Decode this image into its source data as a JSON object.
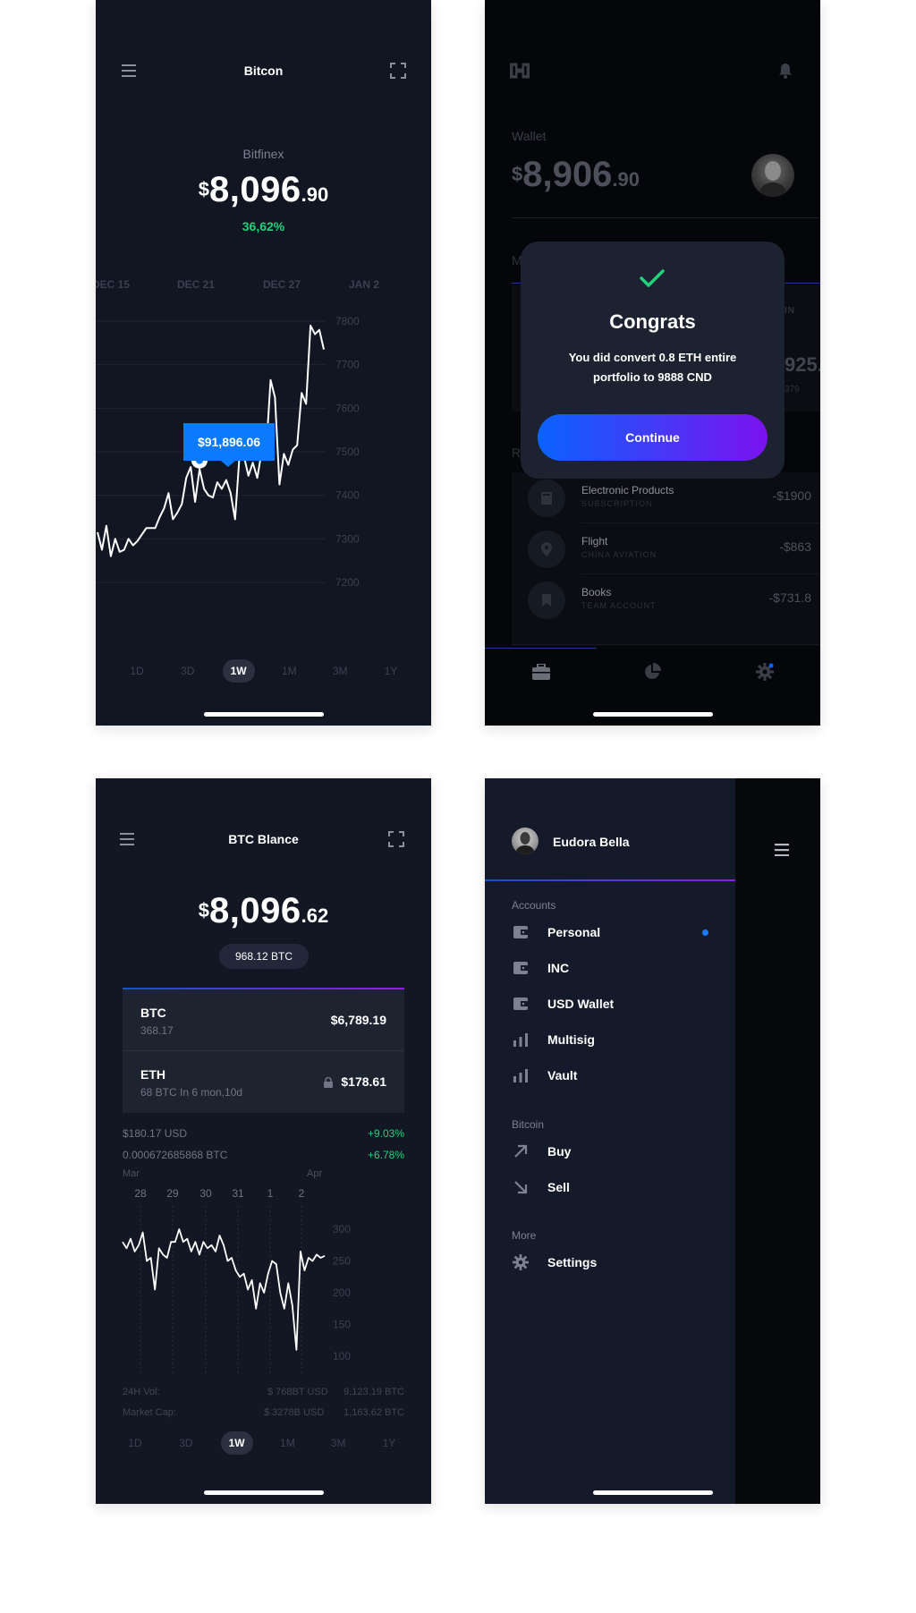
{
  "screen1": {
    "title": "Bitcon",
    "exchange": "Bitfinex",
    "price": {
      "currency": "$",
      "whole": "8,096",
      "cents": ".90"
    },
    "change": "36,62%",
    "date_labels": [
      "DEC 15",
      "DEC 21",
      "DEC 27",
      "JAN 2"
    ],
    "tooltip": "$91,896.06",
    "ranges": [
      "1D",
      "3D",
      "1W",
      "1M",
      "3M",
      "1Y"
    ],
    "active_range": "1W",
    "chart_data": {
      "type": "line",
      "ylim": [
        7200,
        7800
      ],
      "yticks": [
        "7800",
        "7700",
        "7600",
        "7500",
        "7400",
        "7300",
        "7200"
      ],
      "x_tick_labels": [
        "DEC 15",
        "DEC 21",
        "DEC 27",
        "JAN 2"
      ],
      "y": [
        7315,
        7275,
        7330,
        7260,
        7300,
        7270,
        7275,
        7300,
        7285,
        7295,
        7310,
        7325,
        7325,
        7325,
        7350,
        7370,
        7405,
        7345,
        7360,
        7380,
        7440,
        7465,
        7385,
        7460,
        7415,
        7400,
        7395,
        7430,
        7415,
        7435,
        7405,
        7345,
        7490,
        7490,
        7445,
        7475,
        7440,
        7500,
        7500,
        7665,
        7625,
        7425,
        7495,
        7470,
        7505,
        7515,
        7635,
        7610,
        7790,
        7770,
        7780,
        7735
      ],
      "highlight": {
        "value": "$91,896.06"
      }
    }
  },
  "screen2": {
    "wallet_label": "Wallet",
    "price": {
      "currency": "$",
      "whole": "8,906",
      "cents": ".90"
    },
    "partial_labels": {
      "left_m": "M",
      "left_r": "R",
      "right_in": "IN",
      "right_num": "925.",
      "right_small": "379"
    },
    "modal": {
      "title": "Congrats",
      "message_line1": "You did convert 0.8 ETH entire",
      "message_line2": "portfolio to 9888 CND",
      "button": "Continue"
    },
    "transactions": [
      {
        "name": "Electronic Products",
        "sub": "SUBSCRIPTION",
        "amount": "-$1900",
        "icon": "book-icon"
      },
      {
        "name": "Flight",
        "sub": "CHINA AVIATION",
        "amount": "-$863",
        "icon": "location-pin-icon"
      },
      {
        "name": "Books",
        "sub": "TEAM ACCOUNT",
        "amount": "-$731.8",
        "icon": "bookmark-icon"
      }
    ],
    "tabs": [
      "briefcase-icon",
      "pie-chart-icon",
      "gear-icon"
    ]
  },
  "screen3": {
    "title": "BTC Blance",
    "price": {
      "currency": "$",
      "whole": "8,096",
      "cents": ".62"
    },
    "btc_pill": "968.12 BTC",
    "coins": [
      {
        "symbol": "BTC",
        "sub": "368.17",
        "value": "$6,789.19"
      },
      {
        "symbol": "ETH",
        "sub": "68 BTC In 6 mon,10d",
        "value": "$178.61"
      }
    ],
    "stats": [
      {
        "label": "$180.17 USD",
        "change": "+9.03%"
      },
      {
        "label": "0.000672685868 BTC",
        "change": "+6.78%"
      }
    ],
    "months": [
      "Mar",
      "Apr"
    ],
    "days": [
      "28",
      "29",
      "30",
      "31",
      "1",
      "2"
    ],
    "footer": [
      {
        "label": "24H Vol:",
        "usd": "$ 768BT USD",
        "btc": "9,123.19 BTC"
      },
      {
        "label": "Market Cap:",
        "usd": "$ 3278B USD",
        "btc": "1,163.62 BTC"
      }
    ],
    "ranges": [
      "1D",
      "3D",
      "1W",
      "1M",
      "3M",
      "1Y"
    ],
    "active_range": "1W",
    "chart_data": {
      "type": "line",
      "ylim": [
        100,
        300
      ],
      "yticks": [
        "300",
        "250",
        "200",
        "150",
        "100"
      ],
      "x_tick_labels": [
        "28",
        "29",
        "30",
        "31",
        "1",
        "2"
      ],
      "y": [
        280,
        270,
        285,
        265,
        275,
        295,
        250,
        255,
        205,
        270,
        260,
        255,
        280,
        280,
        300,
        280,
        285,
        265,
        280,
        260,
        280,
        270,
        275,
        265,
        290,
        275,
        250,
        255,
        235,
        225,
        230,
        205,
        220,
        175,
        215,
        200,
        230,
        250,
        245,
        200,
        175,
        215,
        180,
        110,
        265,
        235,
        255,
        250,
        260,
        255,
        258
      ]
    }
  },
  "screen4": {
    "user": "Eudora Bella",
    "sections": [
      {
        "label": "Accounts",
        "items": [
          {
            "label": "Personal",
            "icon": "wallet-icon",
            "dot": true
          },
          {
            "label": "INC",
            "icon": "wallet-icon"
          },
          {
            "label": "USD Wallet",
            "icon": "wallet-icon"
          },
          {
            "label": "Multisig",
            "icon": "bars-icon"
          },
          {
            "label": "Vault",
            "icon": "bars-icon"
          }
        ]
      },
      {
        "label": "Bitcoin",
        "items": [
          {
            "label": "Buy",
            "icon": "arrow-up-right-icon"
          },
          {
            "label": "Sell",
            "icon": "arrow-down-right-icon"
          }
        ]
      },
      {
        "label": "More",
        "items": [
          {
            "label": "Settings",
            "icon": "gear-icon"
          }
        ]
      }
    ]
  }
}
